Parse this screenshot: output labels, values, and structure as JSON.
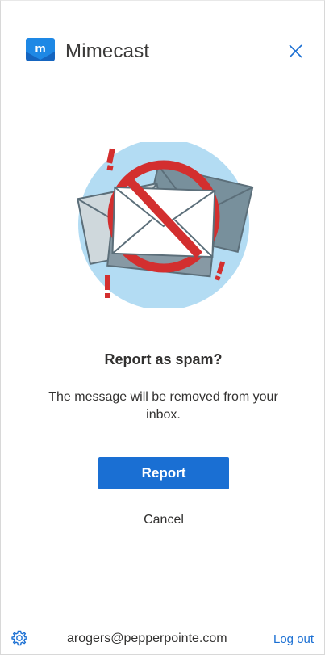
{
  "colors": {
    "brand_blue": "#1a6fd3",
    "logo_blue": "#1e88e5",
    "circle_bg": "#b3dcf3",
    "prohibition_red": "#d32f2f",
    "envelope_gray": "#78909c"
  },
  "header": {
    "app_name": "Mimecast",
    "logo_icon": "mimecast-logo",
    "close_icon": "close-icon"
  },
  "dialog": {
    "title": "Report as spam?",
    "message": "The message will be removed from your inbox.",
    "report_label": "Report",
    "cancel_label": "Cancel"
  },
  "footer": {
    "settings_icon": "gear-icon",
    "user_email": "arogers@pepperpointe.com",
    "logout_label": "Log out"
  }
}
